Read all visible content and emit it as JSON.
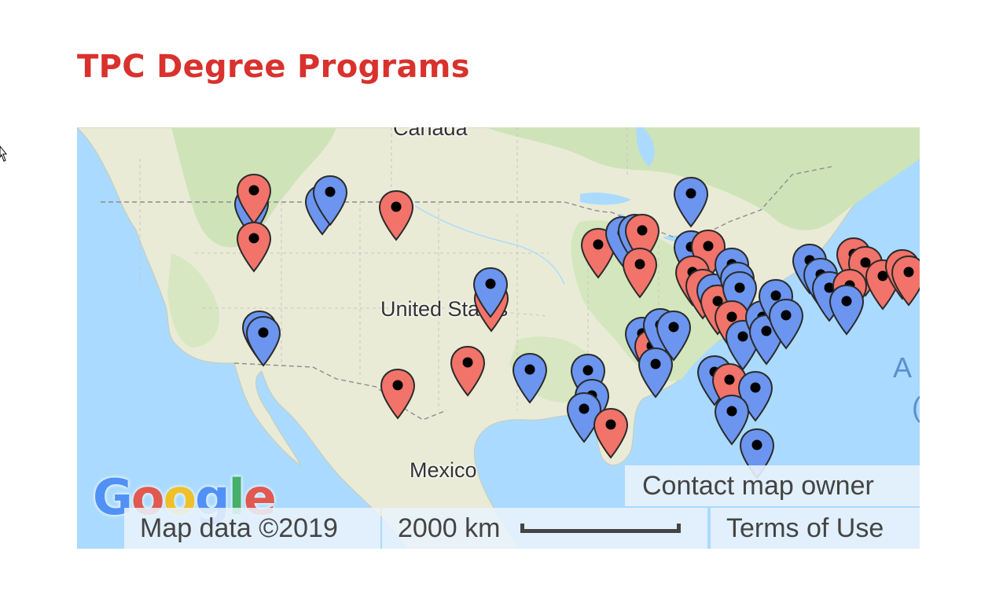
{
  "page": {
    "title": "TPC Degree Programs"
  },
  "map": {
    "labels": {
      "country_north": "Canada",
      "country_center": "United States",
      "country_south": "Mexico",
      "ocean_fragment_1": "A",
      "ocean_fragment_2": "("
    },
    "google_logo": {
      "letters": [
        "G",
        "o",
        "o",
        "g",
        "l",
        "e"
      ],
      "colors": [
        "#4285f4",
        "#ea4335",
        "#fbbc05",
        "#4285f4",
        "#34a853",
        "#ea4335"
      ]
    },
    "attribution": {
      "map_data": "Map data ©2019",
      "scale_label": "2000 km",
      "terms": "Terms of Use",
      "contact": "Contact map owner"
    },
    "marker_colors": {
      "red": "#f1736a",
      "blue": "#6b95ef"
    },
    "markers": [
      {
        "color": "blue",
        "lon": -123.0,
        "lat": 47.2
      },
      {
        "color": "red",
        "lon": -122.8,
        "lat": 48.2
      },
      {
        "color": "blue",
        "lon": -117.6,
        "lat": 47.4
      },
      {
        "color": "blue",
        "lon": -117.0,
        "lat": 48.1
      },
      {
        "color": "red",
        "lon": -112.0,
        "lat": 47.0
      },
      {
        "color": "red",
        "lon": -122.8,
        "lat": 44.6
      },
      {
        "color": "blue",
        "lon": -122.4,
        "lat": 37.8
      },
      {
        "color": "blue",
        "lon": -122.1,
        "lat": 37.4
      },
      {
        "color": "red",
        "lon": -104.8,
        "lat": 40.0
      },
      {
        "color": "blue",
        "lon": -104.9,
        "lat": 41.1
      },
      {
        "color": "red",
        "lon": -111.9,
        "lat": 33.4
      },
      {
        "color": "red",
        "lon": -106.6,
        "lat": 35.1
      },
      {
        "color": "blue",
        "lon": -101.9,
        "lat": 34.6
      },
      {
        "color": "blue",
        "lon": -97.5,
        "lat": 34.5
      },
      {
        "color": "blue",
        "lon": -97.2,
        "lat": 32.6
      },
      {
        "color": "blue",
        "lon": -97.8,
        "lat": 31.6
      },
      {
        "color": "red",
        "lon": -95.8,
        "lat": 30.4
      },
      {
        "color": "red",
        "lon": -96.7,
        "lat": 44.1
      },
      {
        "color": "blue",
        "lon": -94.9,
        "lat": 45.0
      },
      {
        "color": "blue",
        "lon": -93.9,
        "lat": 45.2
      },
      {
        "color": "red",
        "lon": -93.4,
        "lat": 45.2
      },
      {
        "color": "red",
        "lon": -93.6,
        "lat": 42.6
      },
      {
        "color": "blue",
        "lon": -89.7,
        "lat": 48.0
      },
      {
        "color": "blue",
        "lon": -93.4,
        "lat": 37.3
      },
      {
        "color": "red",
        "lon": -92.7,
        "lat": 36.4
      },
      {
        "color": "blue",
        "lon": -92.0,
        "lat": 38.0
      },
      {
        "color": "blue",
        "lon": -91.0,
        "lat": 37.8
      },
      {
        "color": "blue",
        "lon": -92.4,
        "lat": 35.0
      },
      {
        "color": "blue",
        "lon": -89.7,
        "lat": 43.9
      },
      {
        "color": "red",
        "lon": -88.4,
        "lat": 44.0
      },
      {
        "color": "red",
        "lon": -89.6,
        "lat": 42.0
      },
      {
        "color": "red",
        "lon": -88.8,
        "lat": 41.0
      },
      {
        "color": "blue",
        "lon": -88.0,
        "lat": 40.6
      },
      {
        "color": "red",
        "lon": -87.7,
        "lat": 39.8
      },
      {
        "color": "blue",
        "lon": -86.6,
        "lat": 42.6
      },
      {
        "color": "blue",
        "lon": -86.2,
        "lat": 41.5
      },
      {
        "color": "blue",
        "lon": -86.0,
        "lat": 40.8
      },
      {
        "color": "red",
        "lon": -86.6,
        "lat": 38.6
      },
      {
        "color": "blue",
        "lon": -85.8,
        "lat": 37.1
      },
      {
        "color": "blue",
        "lon": -84.3,
        "lat": 38.6
      },
      {
        "color": "blue",
        "lon": -84.0,
        "lat": 37.5
      },
      {
        "color": "blue",
        "lon": -83.3,
        "lat": 40.2
      },
      {
        "color": "blue",
        "lon": -82.5,
        "lat": 38.7
      },
      {
        "color": "blue",
        "lon": -87.9,
        "lat": 34.4
      },
      {
        "color": "red",
        "lon": -86.8,
        "lat": 33.8
      },
      {
        "color": "blue",
        "lon": -84.8,
        "lat": 33.2
      },
      {
        "color": "blue",
        "lon": -86.6,
        "lat": 31.4
      },
      {
        "color": "blue",
        "lon": -84.7,
        "lat": 28.8
      },
      {
        "color": "blue",
        "lon": -80.7,
        "lat": 42.9
      },
      {
        "color": "blue",
        "lon": -79.9,
        "lat": 41.8
      },
      {
        "color": "blue",
        "lon": -79.2,
        "lat": 40.8
      },
      {
        "color": "red",
        "lon": -77.4,
        "lat": 43.4
      },
      {
        "color": "red",
        "lon": -76.5,
        "lat": 42.7
      },
      {
        "color": "red",
        "lon": -77.7,
        "lat": 41.0
      },
      {
        "color": "red",
        "lon": -75.2,
        "lat": 41.7
      },
      {
        "color": "red",
        "lon": -73.7,
        "lat": 42.5
      },
      {
        "color": "red",
        "lon": -73.2,
        "lat": 42.0
      },
      {
        "color": "blue",
        "lon": -77.9,
        "lat": 39.8
      }
    ]
  }
}
